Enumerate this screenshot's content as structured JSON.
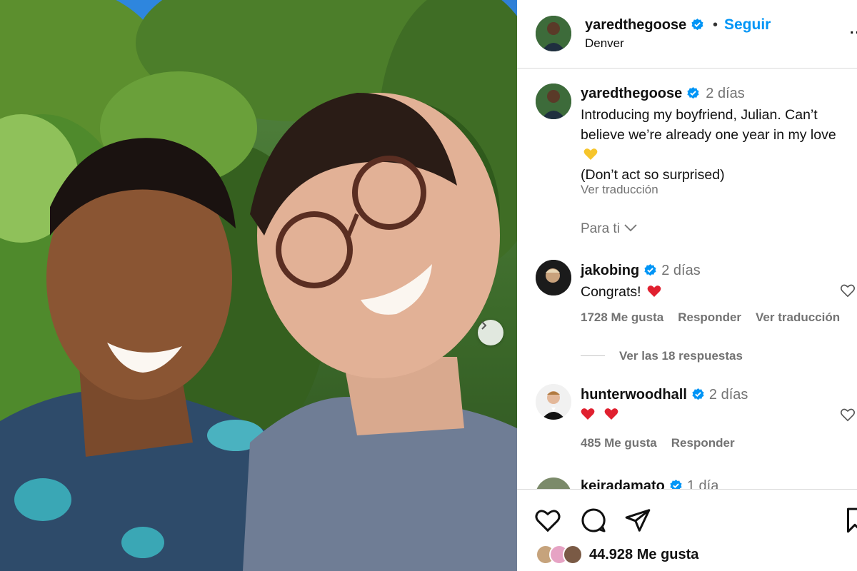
{
  "post": {
    "author": "yaredthegoose",
    "follow_label": "Seguir",
    "separator": "•",
    "location": "Denver",
    "more": "..."
  },
  "caption": {
    "author": "yaredthegoose",
    "time": "2 días",
    "line1": "Introducing my boyfriend, Julian. Can’t believe we’re already one year in my love",
    "line2": "(Don’t act so surprised)",
    "see_translation": "Ver traducción",
    "for_you": "Para ti"
  },
  "comments": [
    {
      "author": "jakobing",
      "time": "2 días",
      "text": "Congrats!",
      "likes": "1728 Me gusta",
      "reply": "Responder",
      "translate": "Ver traducción",
      "replies": "Ver las 18 respuestas"
    },
    {
      "author": "hunterwoodhall",
      "time": "2 días",
      "likes": "485 Me gusta",
      "reply": "Responder"
    },
    {
      "author": "keiradamato",
      "time": "1 día"
    }
  ],
  "footer": {
    "likes_count": "44.928 Me gusta"
  },
  "colors": {
    "link_blue": "#0095f6",
    "verified_blue": "#0095f6",
    "heart_red": "#e0202f",
    "heart_yellow": "#f6c52b",
    "muted": "#737373"
  },
  "icons": [
    "verified-icon",
    "chevron-right-icon",
    "chevron-down-icon",
    "heart-icon",
    "comment-icon",
    "share-icon",
    "bookmark-icon"
  ]
}
